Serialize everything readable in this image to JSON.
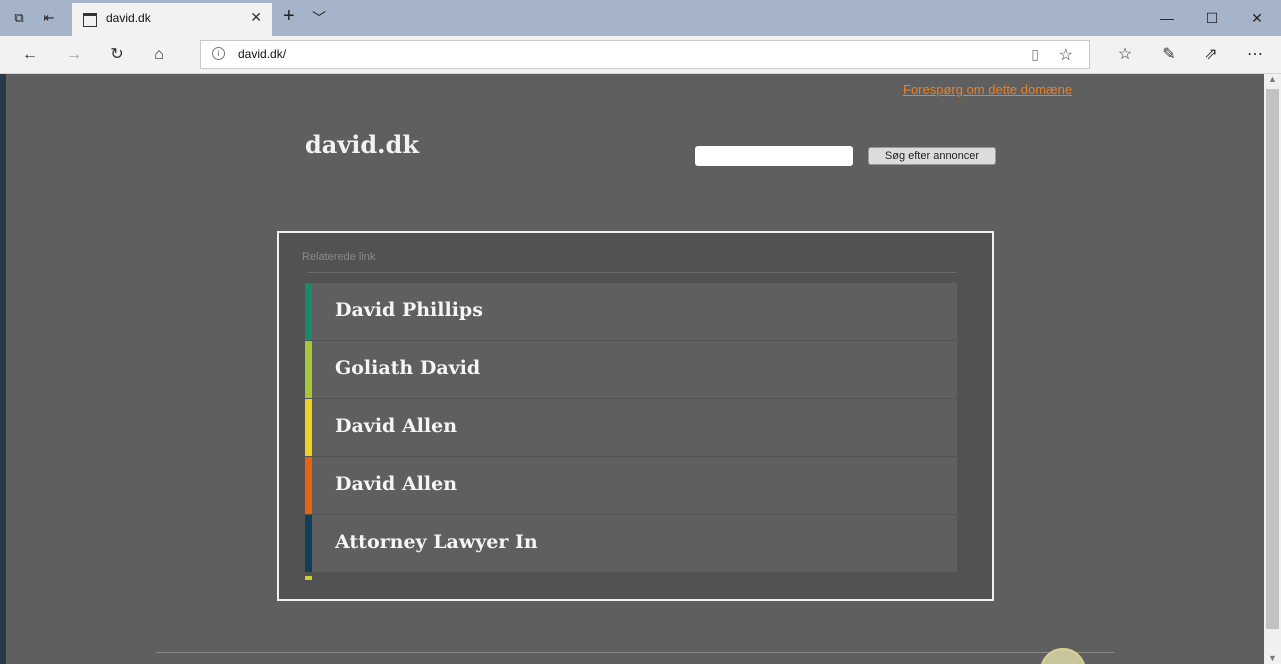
{
  "browser": {
    "tab": {
      "title": "david.dk",
      "close": "✕"
    },
    "new_tab": "+",
    "tab_menu": "﹀",
    "window": {
      "minimize": "—",
      "maximize": "☐",
      "close": "✕"
    },
    "address": {
      "url": "david.dk/",
      "info": "i"
    },
    "toolbar_icons": [
      "back-icon",
      "forward-icon",
      "refresh-icon",
      "home-icon",
      "reading-view-icon",
      "favorite-star-icon",
      "favorites-list-icon",
      "pen-icon",
      "share-icon",
      "more-icon"
    ]
  },
  "page": {
    "inquiry_link": "Forespørg om dette domæne",
    "site_title": "david.dk",
    "search": {
      "button": "Søg efter annoncer",
      "value": ""
    },
    "related": {
      "heading": "Relaterede link",
      "items": [
        {
          "label": "David Phillips",
          "color": "#1b8a6b"
        },
        {
          "label": "Goliath David",
          "color": "#a5c83a"
        },
        {
          "label": "David Allen",
          "color": "#f0d020"
        },
        {
          "label": "David Allen",
          "color": "#e8650f"
        },
        {
          "label": "Attorney Lawyer In",
          "color": "#0f3f5a"
        }
      ]
    }
  },
  "colors": {
    "background": "#5f5f5f",
    "panel": "#525252",
    "link_accent": "#f07f1e"
  }
}
